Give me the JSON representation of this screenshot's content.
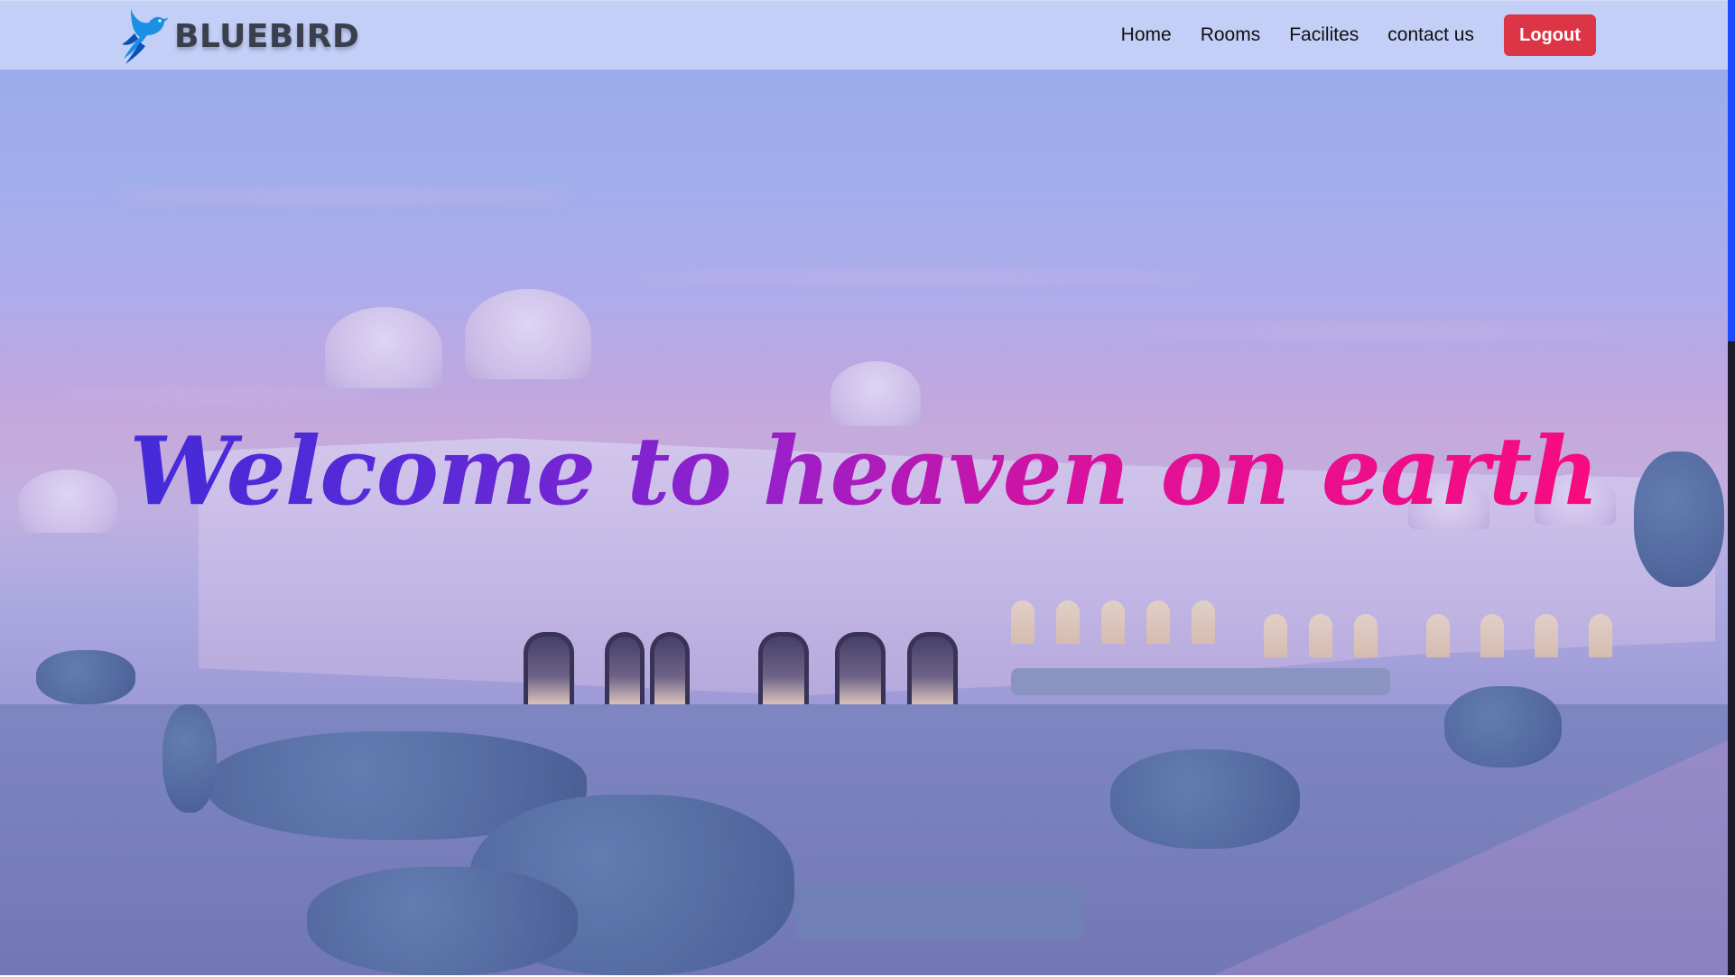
{
  "navbar": {
    "brand_name": "BLUEBIRD",
    "brand_logo_icon": "bluebird-logo-icon",
    "links": [
      {
        "label": "Home"
      },
      {
        "label": "Rooms"
      },
      {
        "label": "Facilites"
      },
      {
        "label": "contact us"
      }
    ],
    "logout_label": "Logout"
  },
  "hero": {
    "headline": "Welcome to heaven on earth",
    "background_image": "palace-hotel-photo",
    "gradient_colors": [
      "#3b2bd9",
      "#9a1fc8",
      "#ff0a78"
    ]
  },
  "colors": {
    "logout_button": "#dc3545",
    "navbar_bg": "#c8d4f8",
    "scroll_accent": "#1f4bff"
  }
}
